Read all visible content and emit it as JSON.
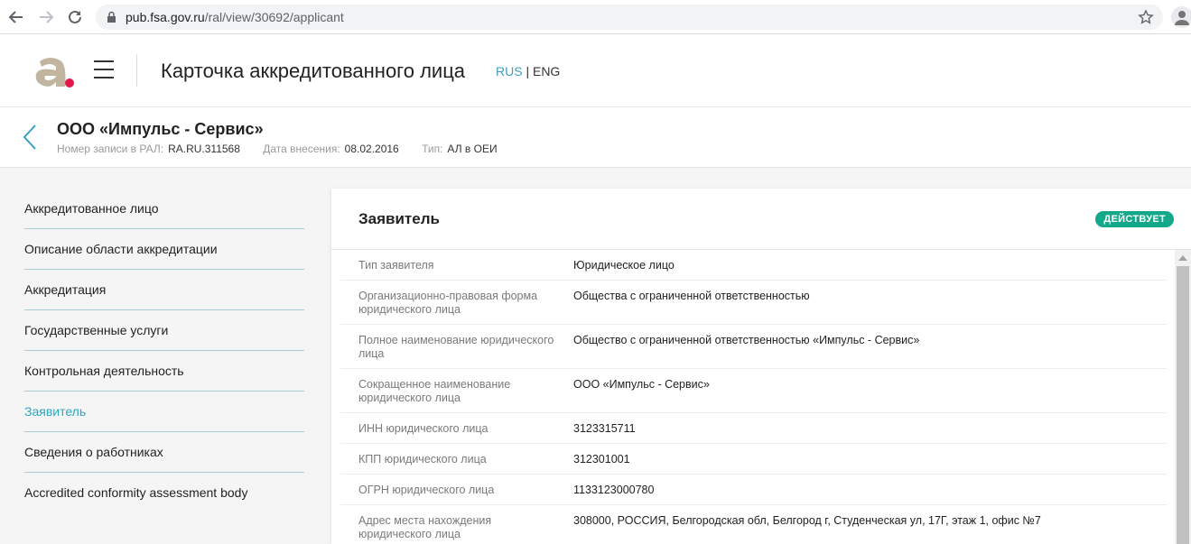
{
  "browser": {
    "url_host": "pub.fsa.gov.ru",
    "url_path": "/ral/view/30692/applicant"
  },
  "header": {
    "title": "Карточка аккредитованного лица",
    "lang_ru": "RUS",
    "lang_sep": " | ",
    "lang_en": "ENG"
  },
  "entity": {
    "name": "ООО «Импульс - Сервис»",
    "record_label": "Номер записи в РАЛ:",
    "record_value": "RA.RU.311568",
    "date_label": "Дата внесения:",
    "date_value": "08.02.2016",
    "type_label": "Тип:",
    "type_value": "АЛ в ОЕИ"
  },
  "sidebar": {
    "items": [
      {
        "label": "Аккредитованное лицо"
      },
      {
        "label": "Описание области аккредитации"
      },
      {
        "label": "Аккредитация"
      },
      {
        "label": "Государственные услуги"
      },
      {
        "label": "Контрольная деятельность"
      },
      {
        "label": "Заявитель"
      },
      {
        "label": "Сведения о работниках"
      },
      {
        "label": "Accredited conformity assessment body"
      }
    ]
  },
  "card": {
    "title": "Заявитель",
    "status": "ДЕЙСТВУЕТ",
    "rows": [
      {
        "label": "Тип заявителя",
        "value": "Юридическое лицо"
      },
      {
        "label": "Организационно-правовая форма юридического лица",
        "value": "Общества с ограниченной ответственностью"
      },
      {
        "label": "Полное наименование юридического лица",
        "value": "Общество с ограниченной ответственностью «Импульс - Сервис»"
      },
      {
        "label": "Сокращенное наименование юридического лица",
        "value": "ООО «Импульс - Сервис»"
      },
      {
        "label": "ИНН юридического лица",
        "value": "3123315711"
      },
      {
        "label": "КПП юридического лица",
        "value": "312301001"
      },
      {
        "label": "ОГРН юридического лица",
        "value": "1133123000780"
      },
      {
        "label": "Адрес места нахождения юридического лица",
        "value": "308000, РОССИЯ, Белгородская обл, Белгород г, Студенческая ул, 17Г, этаж 1, офис №7"
      }
    ]
  }
}
